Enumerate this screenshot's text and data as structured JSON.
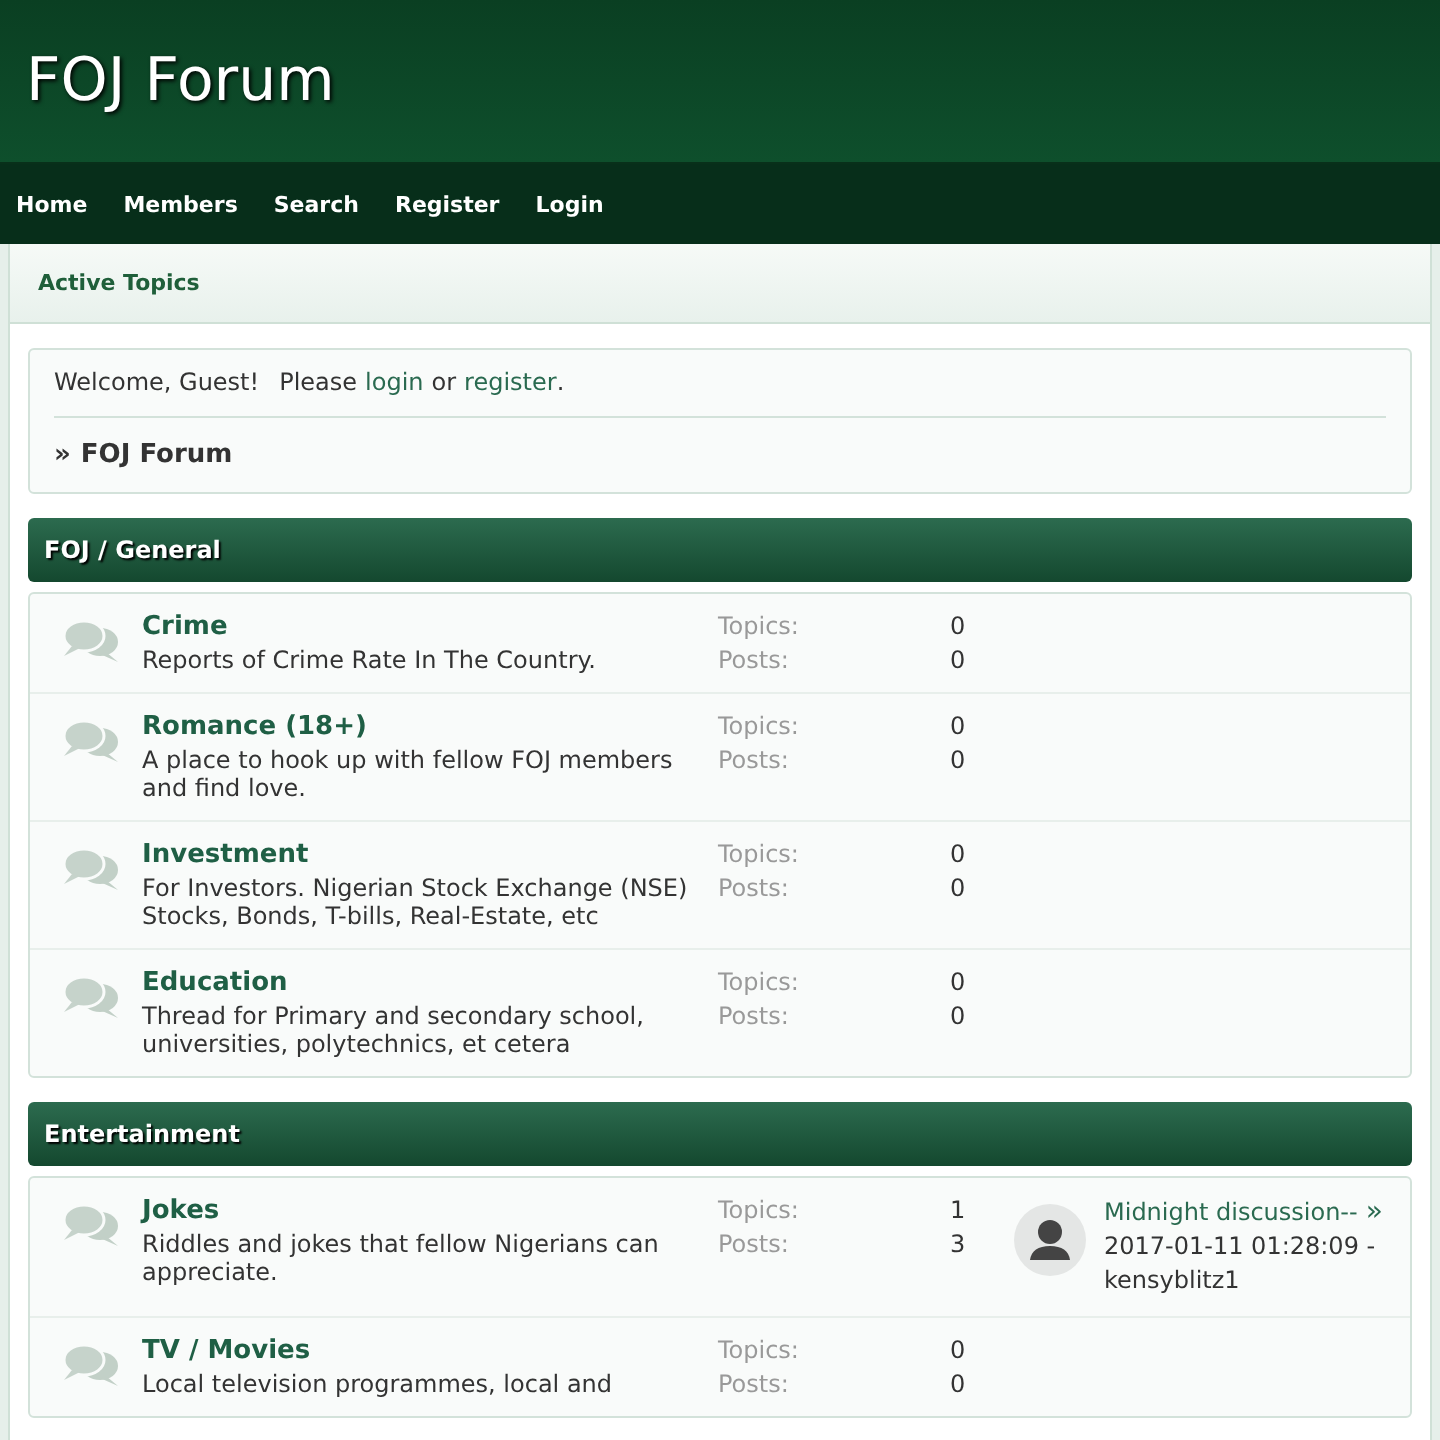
{
  "site_title": "FOJ Forum",
  "nav": [
    "Home",
    "Members",
    "Search",
    "Register",
    "Login"
  ],
  "subnav": [
    "Active Topics"
  ],
  "welcome": {
    "greeting": "Welcome, Guest!",
    "prompt": "Please",
    "login": "login",
    "or": "or",
    "register": "register",
    "end": "."
  },
  "breadcrumb": {
    "marker": "»",
    "label": "FOJ Forum"
  },
  "categories": [
    {
      "title": "FOJ / General",
      "forums": [
        {
          "name": "Crime",
          "description": "Reports of Crime Rate In The Country.",
          "topics_label": "Topics:",
          "topics": "0",
          "posts_label": "Posts:",
          "posts": "0"
        },
        {
          "name": "Romance (18+)",
          "description": "A place to hook up with fellow FOJ members and find love.",
          "topics_label": "Topics:",
          "topics": "0",
          "posts_label": "Posts:",
          "posts": "0"
        },
        {
          "name": "Investment",
          "description": "For Investors. Nigerian Stock Exchange (NSE) Stocks, Bonds, T-bills, Real-Estate, etc",
          "topics_label": "Topics:",
          "topics": "0",
          "posts_label": "Posts:",
          "posts": "0"
        },
        {
          "name": "Education",
          "description": "Thread for Primary and secondary school, universities, polytechnics, et cetera",
          "topics_label": "Topics:",
          "topics": "0",
          "posts_label": "Posts:",
          "posts": "0"
        }
      ]
    },
    {
      "title": "Entertainment",
      "forums": [
        {
          "name": "Jokes",
          "description": "Riddles and jokes that fellow Nigerians can appreciate.",
          "topics_label": "Topics:",
          "topics": "1",
          "posts_label": "Posts:",
          "posts": "3",
          "last_post": {
            "title": "Midnight discussion--",
            "go": "»",
            "date": "2017-01-11 01:28:09 -",
            "user": "kensyblitz1"
          }
        },
        {
          "name": "TV / Movies",
          "description": "Local television programmes, local and",
          "topics_label": "Topics:",
          "topics": "0",
          "posts_label": "Posts:",
          "posts": "0"
        }
      ]
    }
  ]
}
